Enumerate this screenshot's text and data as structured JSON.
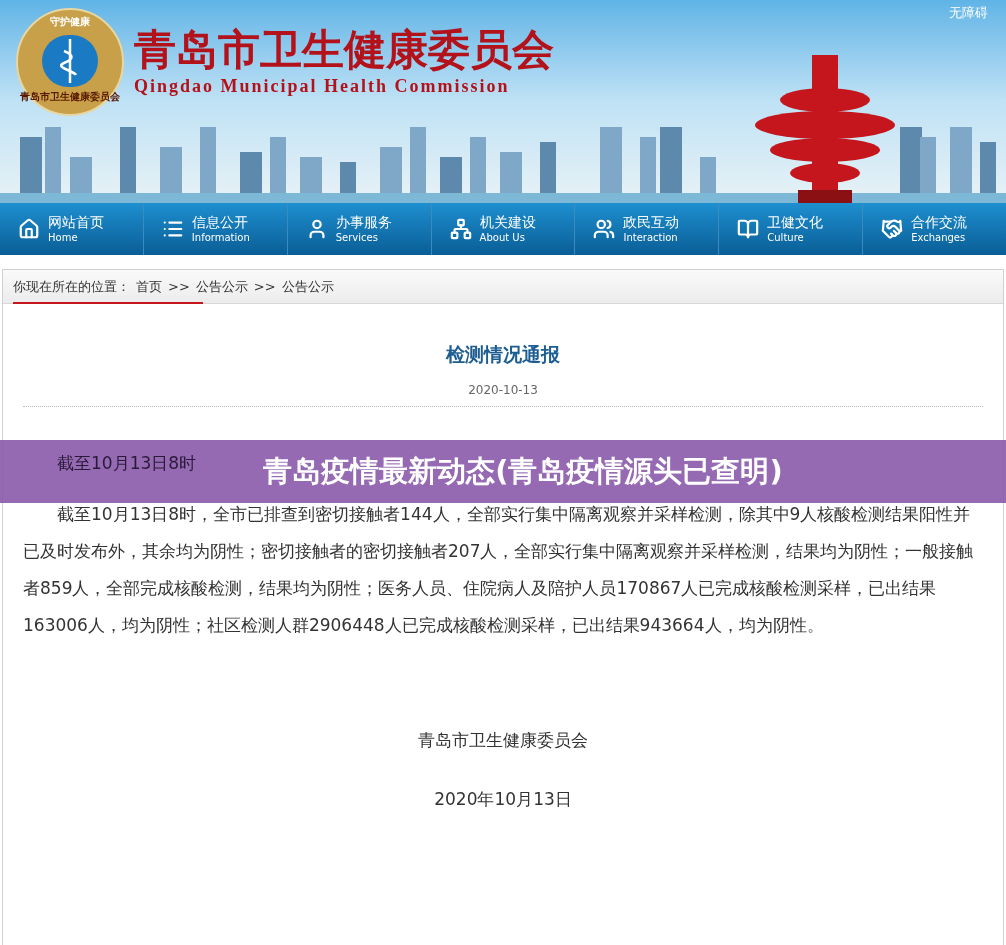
{
  "header": {
    "title": "青岛市卫生健康委员会",
    "subtitle": "Qingdao Municipal Health Commission",
    "logo_top": "守护健康",
    "logo_bottom": "青岛市卫生健康委员会",
    "accessibility_link": "无障碍"
  },
  "nav": [
    {
      "label": "网站首页",
      "sub": "Home",
      "kind": "home"
    },
    {
      "label": "信息公开",
      "sub": "Information",
      "kind": "list"
    },
    {
      "label": "办事服务",
      "sub": "Services",
      "kind": "user"
    },
    {
      "label": "机关建设",
      "sub": "About Us",
      "kind": "network"
    },
    {
      "label": "政民互动",
      "sub": "Interaction",
      "kind": "users"
    },
    {
      "label": "卫健文化",
      "sub": "Culture",
      "kind": "book"
    },
    {
      "label": "合作交流",
      "sub": "Exchanges",
      "kind": "handshake"
    }
  ],
  "breadcrumb": {
    "prefix": "你现在所在的位置：",
    "items": [
      "首页",
      "公告公示",
      "公告公示"
    ],
    "separator": ">>"
  },
  "article": {
    "title": "检测情况通报",
    "date": "2020-10-13",
    "paragraphs": [
      "截至10月13日8时",
      "截至10月13日8时，全市已排查到密切接触者144人，全部实行集中隔离观察并采样检测，除其中9人核酸检测结果阳性并已及时发布外，其余均为阴性；密切接触者的密切接触者207人，全部实行集中隔离观察并采样检测，结果均为阴性；一般接触者859人，全部完成核酸检测，结果均为阴性；医务人员、住院病人及陪护人员170867人已完成核酸检测采样，已出结果163006人，均为阴性；社区检测人群2906448人已完成核酸检测采样，已出结果943664人，均为阴性。"
    ],
    "signature": "青岛市卫生健康委员会",
    "signed_date": "2020年10月13日"
  },
  "overlay_caption": "青岛疫情最新动态(青岛疫情源头已查明)"
}
